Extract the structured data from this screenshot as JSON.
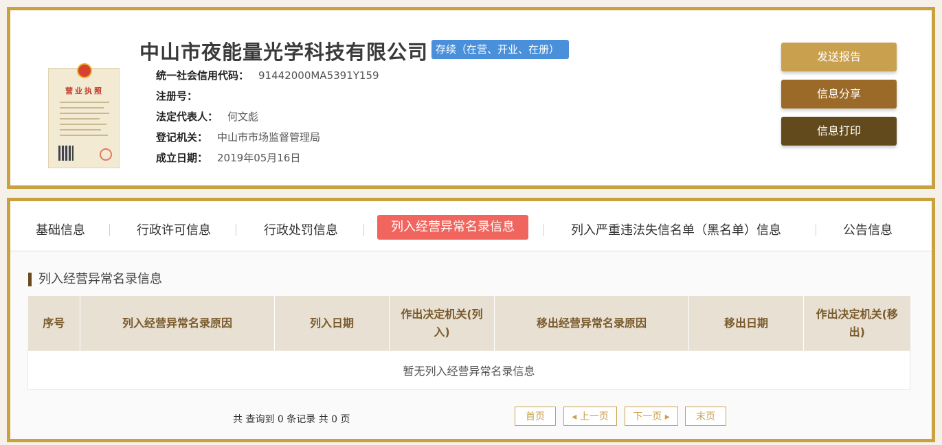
{
  "company": {
    "name": "中山市夜能量光学科技有限公司",
    "status": "存续（在营、开业、在册）",
    "license_title": "营业执照"
  },
  "info": [
    {
      "label": "统一社会信用代码：",
      "value": "91442000MA5391Y159"
    },
    {
      "label": "注册号：",
      "value": ""
    },
    {
      "label": "法定代表人：",
      "value": "何文彪"
    },
    {
      "label": "登记机关：",
      "value": "中山市市场监督管理局"
    },
    {
      "label": "成立日期：",
      "value": "2019年05月16日"
    }
  ],
  "actions": {
    "send": "发送报告",
    "share": "信息分享",
    "print": "信息打印"
  },
  "tabs": [
    {
      "label": "基础信息"
    },
    {
      "label": "行政许可信息"
    },
    {
      "label": "行政处罚信息"
    },
    {
      "label": "列入经营异常名录信息"
    },
    {
      "label": "列入严重违法失信名单（黑名单）信息"
    },
    {
      "label": "公告信息"
    }
  ],
  "section": {
    "title": "列入经营异常名录信息",
    "columns": [
      "序号",
      "列入经营异常名录原因",
      "列入日期",
      "作出决定机关(列入)",
      "移出经营异常名录原因",
      "移出日期",
      "作出决定机关(移出)"
    ],
    "empty_text": "暂无列入经营异常名录信息"
  },
  "pagination": {
    "summary": "共 查询到 0 条记录 共 0 页",
    "first": "首页",
    "prev": "◂ 上一页",
    "next": "下一页 ▸",
    "last": "末页"
  },
  "colors": {
    "border": "#c9a141",
    "active_tab": "#f0655e",
    "status_badge": "#4a8fd9"
  }
}
